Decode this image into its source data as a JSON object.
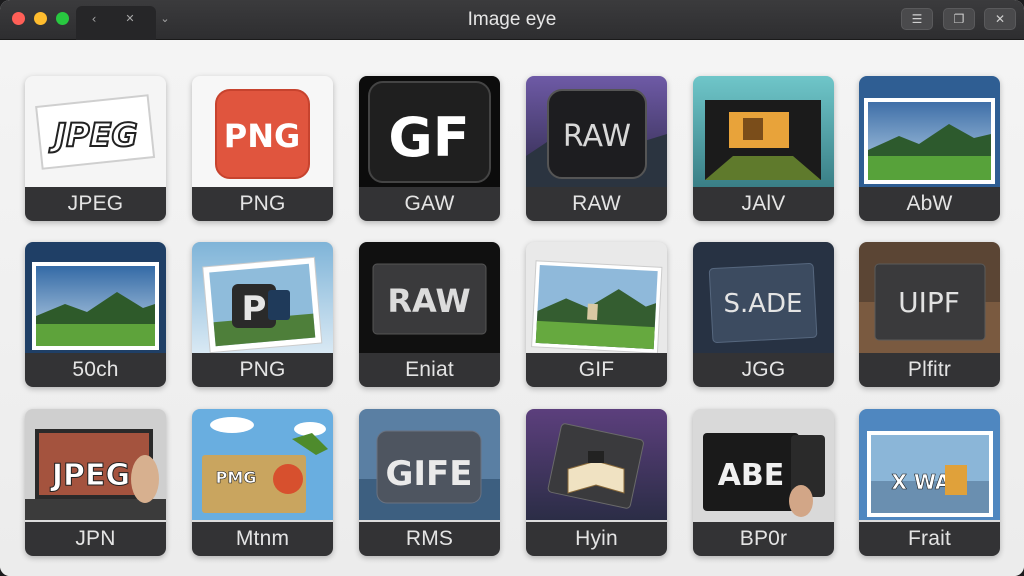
{
  "window": {
    "title": "Image eye",
    "controls": {
      "minimize": "☰",
      "restore": "❐",
      "close": "✕"
    },
    "tab_controls": {
      "back": "‹",
      "close": "✕",
      "menu": "⌄"
    }
  },
  "grid": {
    "items": [
      {
        "label": "JPEG",
        "art_text": "JPEG"
      },
      {
        "label": "PNG",
        "art_text": "PNG"
      },
      {
        "label": "GAW",
        "art_text": "GF"
      },
      {
        "label": "RAW",
        "art_text": "RAW"
      },
      {
        "label": "JAlV",
        "art_text": ""
      },
      {
        "label": "AbW",
        "art_text": ""
      },
      {
        "label": "50ch",
        "art_text": ""
      },
      {
        "label": "PNG",
        "art_text": "P"
      },
      {
        "label": "Eniat",
        "art_text": "RAW"
      },
      {
        "label": "GIF",
        "art_text": ""
      },
      {
        "label": "JGG",
        "art_text": "S.ADE"
      },
      {
        "label": "Plfitr",
        "art_text": "UIPF"
      },
      {
        "label": "JPN",
        "art_text": "JPEG"
      },
      {
        "label": "Mtnm",
        "art_text": "PMG"
      },
      {
        "label": "RMS",
        "art_text": "GIFE"
      },
      {
        "label": "Hyin",
        "art_text": ""
      },
      {
        "label": "BP0r",
        "art_text": "ABE"
      },
      {
        "label": "Frait",
        "art_text": "X WA"
      }
    ]
  },
  "colors": {
    "titlebar": "#333335",
    "content_bg": "#f1f1f1",
    "label_bg": "#333335",
    "png_red": "#e0553e"
  }
}
